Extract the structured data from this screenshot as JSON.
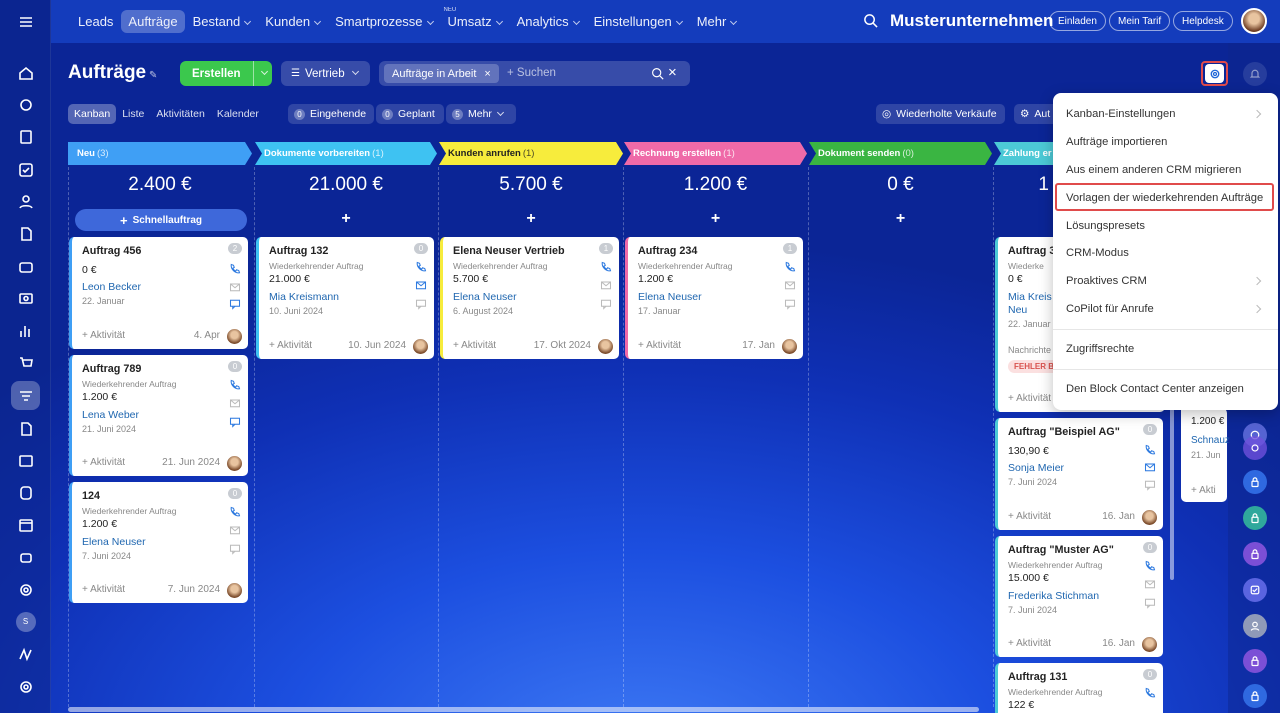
{
  "nav": {
    "items": [
      {
        "label": "Leads"
      },
      {
        "label": "Aufträge"
      },
      {
        "label": "Bestand"
      },
      {
        "label": "Kunden"
      },
      {
        "label": "Smartprozesse"
      },
      {
        "label": "Umsatz",
        "badge": "NEU"
      },
      {
        "label": "Analytics"
      },
      {
        "label": "Einstellungen"
      },
      {
        "label": "Mehr"
      }
    ]
  },
  "company": "Musterunternehmen",
  "top_buttons": {
    "invite": "Einladen",
    "plan": "Mein Tarif",
    "help": "Helpdesk"
  },
  "page": {
    "title": "Aufträge",
    "create": "Erstellen",
    "pipeline": "Vertrieb",
    "filter_tag": "Aufträge in Arbeit",
    "search_placeholder": "+ Suchen"
  },
  "views": [
    "Kanban",
    "Liste",
    "Aktivitäten",
    "Kalender"
  ],
  "counters": {
    "incoming": {
      "n": "0",
      "label": "Eingehende"
    },
    "planned": {
      "n": "0",
      "label": "Geplant"
    },
    "more": {
      "n": "5",
      "label": "Mehr"
    }
  },
  "extra_buttons": {
    "recurring": "Wiederholte Verkäufe",
    "auto": "Aut"
  },
  "stages": [
    {
      "name": "Neu",
      "count": "(3)",
      "sum": "2.400 €",
      "color": "#3f9ff5"
    },
    {
      "name": "Dokumente vorbereiten",
      "count": "(1)",
      "sum": "21.000 €",
      "color": "#3ec2f2"
    },
    {
      "name": "Kunden anrufen",
      "count": "(1)",
      "sum": "5.700 €",
      "color": "#f7ec3c"
    },
    {
      "name": "Rechnung erstellen",
      "count": "(1)",
      "sum": "1.200 €",
      "color": "#ef6aa8"
    },
    {
      "name": "Dokument senden",
      "count": "(0)",
      "sum": "0 €",
      "color": "#3ab542"
    },
    {
      "name": "Zahlung er",
      "count": "",
      "sum": "1",
      "color": "#4cc9d6"
    }
  ],
  "quick_add": "Schnellauftrag",
  "cards": [
    {
      "title": "Auftrag 456",
      "sub": "",
      "amount": "0 €",
      "person": "Leon Becker",
      "date": "22. Januar",
      "badge": "2",
      "act": "+ Aktivität",
      "act_date": "4. Apr"
    },
    {
      "title": "Auftrag 789",
      "sub": "Wiederkehrender Auftrag",
      "amount": "1.200 €",
      "person": "Lena Weber",
      "date": "21. Juni 2024",
      "badge": "0",
      "act": "+ Aktivität",
      "act_date": "21. Jun 2024"
    },
    {
      "title": "124",
      "sub": "Wiederkehrender Auftrag",
      "amount": "1.200 €",
      "person": "Elena Neuser",
      "date": "7. Juni 2024",
      "badge": "0",
      "act": "+ Aktivität",
      "act_date": "7. Jun 2024"
    },
    {
      "title": "Auftrag 132",
      "sub": "Wiederkehrender Auftrag",
      "amount": "21.000 €",
      "person": "Mia Kreismann",
      "date": "10. Juni 2024",
      "badge": "0",
      "act": "+ Aktivität",
      "act_date": "10. Jun 2024"
    },
    {
      "title": "Elena Neuser Vertrieb",
      "sub": "Wiederkehrender Auftrag",
      "amount": "5.700 €",
      "person": "Elena Neuser",
      "date": "6. August 2024",
      "badge": "1",
      "act": "+ Aktivität",
      "act_date": "17. Okt 2024"
    },
    {
      "title": "Auftrag 234",
      "sub": "Wiederkehrender Auftrag",
      "amount": "1.200 €",
      "person": "Elena Neuser",
      "date": "17. Januar",
      "badge": "1",
      "act": "+ Aktivität",
      "act_date": "17. Jan"
    },
    {
      "title": "Auftrag 3",
      "sub": "Wiederke",
      "amount": "0 €",
      "person": "Mia Kreis",
      "person2": "Neu",
      "date": "22. Januar",
      "note": "Nachrichte",
      "err": "FEHLER BE",
      "act": "+ Aktivität"
    },
    {
      "title": "Auftrag \"Beispiel AG\"",
      "sub": "",
      "amount": "130,90 €",
      "person": "Sonja Meier",
      "date": "7. Juni 2024",
      "badge": "0",
      "act": "+ Aktivität",
      "act_date": "16. Jan"
    },
    {
      "title": "Auftrag \"Muster AG\"",
      "sub": "Wiederkehrender Auftrag",
      "amount": "15.000 €",
      "person": "Frederika Stichman",
      "date": "7. Juni 2024",
      "badge": "0",
      "act": "+ Aktivität",
      "act_date": "16. Jan"
    },
    {
      "title": "Auftrag 131",
      "sub": "Wiederkehrender Auftrag",
      "amount": "122 €",
      "badge": "0"
    }
  ],
  "behind": {
    "amount": "1.200 €",
    "person": "Schnauz",
    "date": "21. Jun",
    "act": "+ Akti"
  },
  "menu": [
    "Kanban-Einstellungen",
    "Aufträge importieren",
    "Aus einem anderen CRM migrieren",
    "Vorlagen der wiederkehrenden Aufträge",
    "Lösungspresets",
    "CRM-Modus",
    "Proaktives CRM",
    "CoPilot für Anrufe",
    "Zugriffsrechte",
    "Den Block Contact Center anzeigen"
  ],
  "sidebar_avatar_letter": "S"
}
